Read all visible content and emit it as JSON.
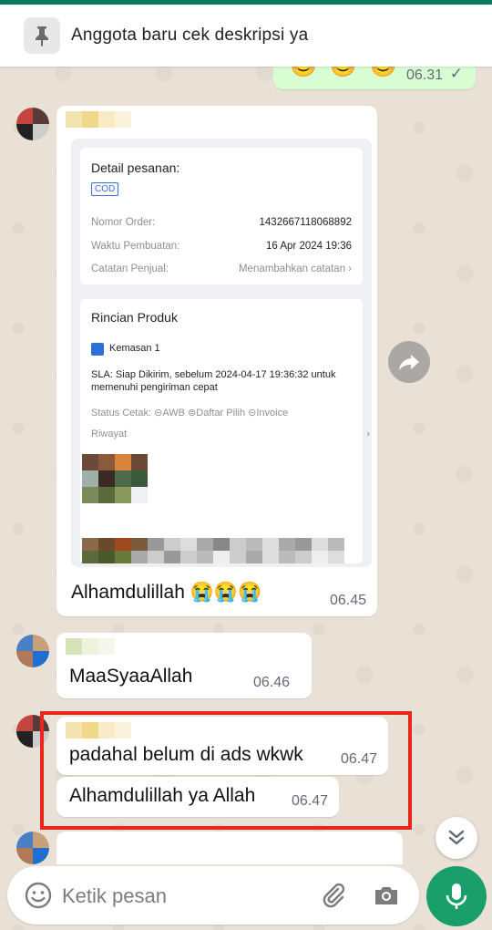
{
  "pinned": {
    "text": "Anggota baru cek deskripsi ya"
  },
  "outgoing": {
    "emojis": "😊😊😊",
    "time": "06.31"
  },
  "order_card": {
    "detail_title": "Detail pesanan:",
    "payment_badge": "COD",
    "rows": [
      {
        "label": "Nomor Order:",
        "value": "1432667118068892"
      },
      {
        "label": "Waktu Pembuatan:",
        "value": "16 Apr 2024 19:36"
      },
      {
        "label": "Catatan Penjual:",
        "value": "Menambahkan catatan"
      }
    ],
    "product_title": "Rincian Produk",
    "package": "Kemasan 1",
    "sla_label": "SLA:",
    "sla_text": "Siap Dikirim, sebelum 2024-04-17 19:36:32 untuk memenuhi pengiriman cepat",
    "status_text": "Status Cetak:",
    "status_items": [
      "AWB",
      "Daftar Pilih",
      "Invoice"
    ],
    "riwayat": "Riwayat",
    "caption": "Alhamdulillah 😭😭😭",
    "time": "06.45"
  },
  "messages": [
    {
      "text": "MaaSyaaAllah",
      "time": "06.46"
    },
    {
      "text": "padahal belum di ads wkwk",
      "time": "06.47"
    },
    {
      "text": "Alhamdulillah ya Allah",
      "time": "06.47"
    }
  ],
  "composer": {
    "placeholder": "Ketik pesan"
  },
  "colors": {
    "accent": "#1a9e6a",
    "outgoing_bubble": "#d9fdd3",
    "highlight": "#e8261a"
  }
}
